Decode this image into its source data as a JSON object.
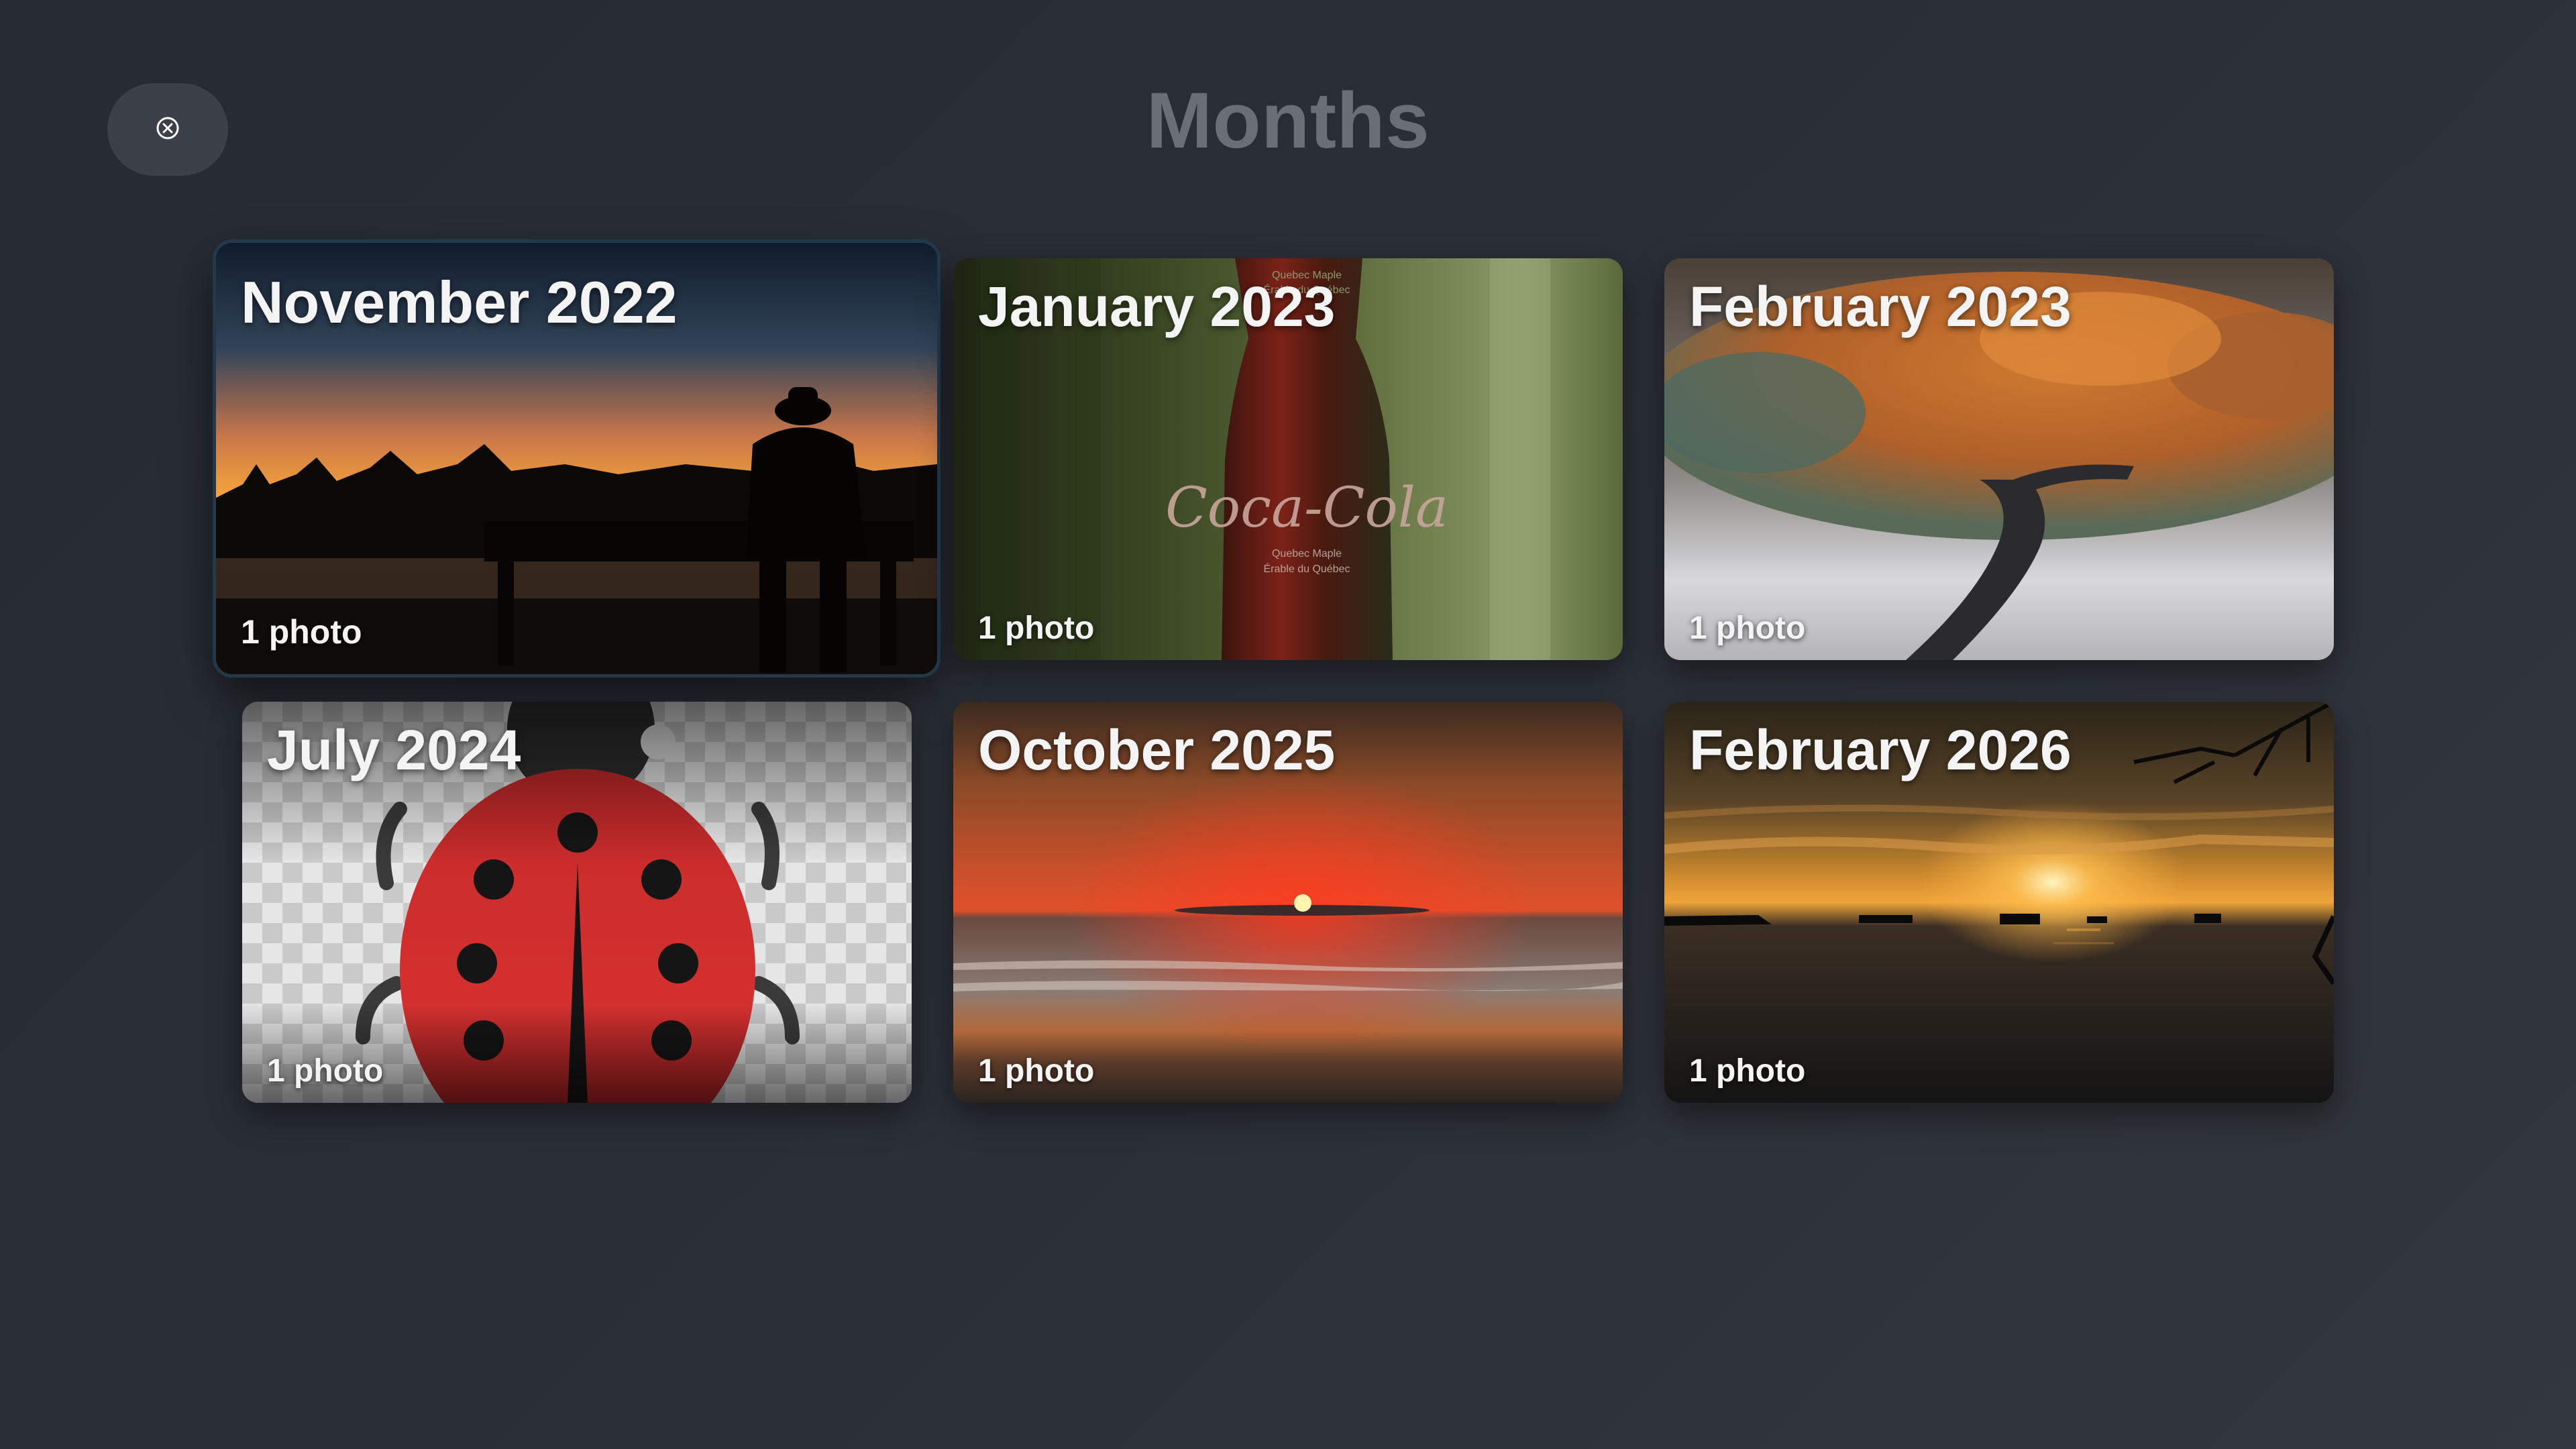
{
  "header": {
    "title": "Months",
    "close_icon": "close-circle-icon"
  },
  "months": [
    {
      "title": "November 2022",
      "count": "1 photo",
      "focused": true,
      "thumbnail": "sunset-silhouette-bench"
    },
    {
      "title": "January 2023",
      "count": "1 photo",
      "focused": false,
      "thumbnail": "coca-cola-bottle"
    },
    {
      "title": "February 2023",
      "count": "1 photo",
      "focused": false,
      "thumbnail": "orange-tree"
    },
    {
      "title": "July 2024",
      "count": "1 photo",
      "focused": false,
      "thumbnail": "ladybug"
    },
    {
      "title": "October 2025",
      "count": "1 photo",
      "focused": false,
      "thumbnail": "red-sunset-beach"
    },
    {
      "title": "February 2026",
      "count": "1 photo",
      "focused": false,
      "thumbnail": "golden-sunset-ships"
    }
  ],
  "thumbnail_text": {
    "bottle_brand": "Coca-Cola",
    "bottle_label_1": "Quebec Maple",
    "bottle_label_2": "Érable du Québec"
  }
}
